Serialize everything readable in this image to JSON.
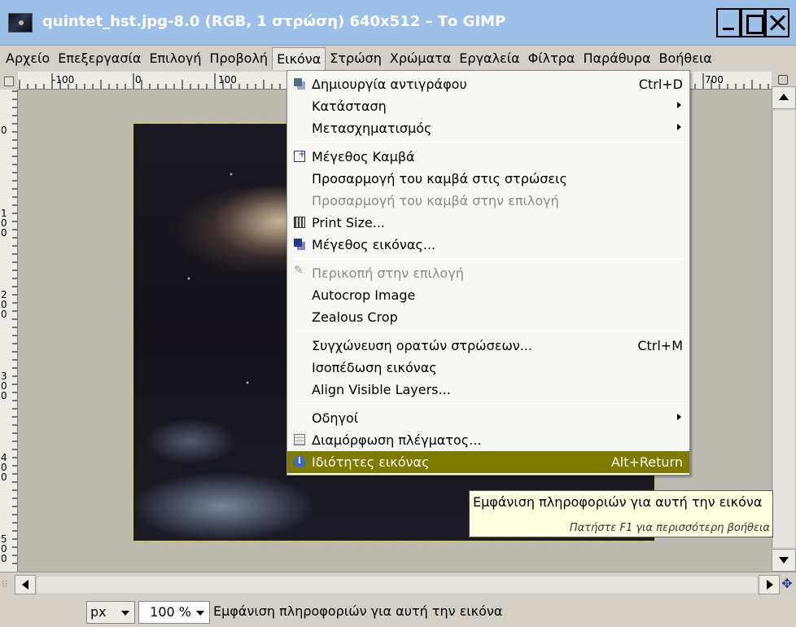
{
  "window": {
    "title": "quintet_hst.jpg-8.0 (RGB, 1 στρώση) 640x512 – Το GIMP"
  },
  "menubar": {
    "items": [
      "Αρχείο",
      "Επεξεργασία",
      "Επιλογή",
      "Προβολή",
      "Εικόνα",
      "Στρώση",
      "Χρώματα",
      "Εργαλεία",
      "Φίλτρα",
      "Παράθυρα",
      "Βοήθεια"
    ],
    "active": "Εικόνα"
  },
  "ruler": {
    "top_labels": [
      "-100",
      "0",
      "100",
      "700"
    ],
    "left_labels": [
      "0",
      "100",
      "200",
      "300",
      "400",
      "500"
    ]
  },
  "image_menu": {
    "items": [
      {
        "label": "Δημιουργία αντιγράφου",
        "accel": "Ctrl+D",
        "icon": "duplicate-icon"
      },
      {
        "label": "Κατάσταση",
        "submenu": true
      },
      {
        "label": "Μετασχηματισμός",
        "submenu": true
      },
      {
        "label": "Μέγεθος Καμβά",
        "icon": "canvas-size-icon"
      },
      {
        "label": "Προσαρμογή του καμβά στις στρώσεις"
      },
      {
        "label": "Προσαρμογή του καμβά στην επιλογή",
        "disabled": true
      },
      {
        "label": "Print Size...",
        "icon": "print-size-icon"
      },
      {
        "label": "Μέγεθος εικόνας...",
        "icon": "scale-image-icon"
      },
      {
        "label": "Περικοπή στην επιλογή",
        "disabled": true,
        "icon": "crop-icon"
      },
      {
        "label": "Autocrop Image"
      },
      {
        "label": "Zealous Crop"
      },
      {
        "label": "Συγχώνευση ορατών στρώσεων...",
        "accel": "Ctrl+M"
      },
      {
        "label": "Ισοπέδωση εικόνας"
      },
      {
        "label": "Align Visible Layers..."
      },
      {
        "label": "Οδηγοί",
        "submenu": true
      },
      {
        "label": "Διαμόρφωση πλέγματος...",
        "icon": "grid-icon"
      },
      {
        "label": "Ιδιότητες εικόνας",
        "accel": "Alt+Return",
        "icon": "info-icon",
        "highlighted": true
      }
    ]
  },
  "tooltip": {
    "text": "Εμφάνιση πληροφοριών για αυτή την εικόνα",
    "hint": "Πατήστε F1 για περισσότερη βοήθεια"
  },
  "statusbar": {
    "unit": "px",
    "zoom": "100 %",
    "message": "Εμφάνιση πληροφοριών για αυτή την εικόνα"
  },
  "colors": {
    "titlebar": "#9cc0e8",
    "menu_highlight": "#7f7a00",
    "tooltip_bg": "#ffffe1"
  }
}
